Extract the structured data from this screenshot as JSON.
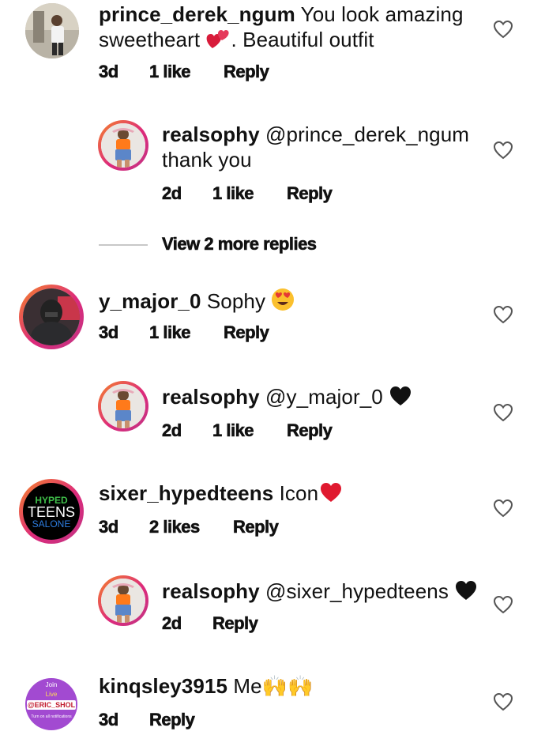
{
  "comments": [
    {
      "username": "prince_derek_ngum",
      "text_line1": " You look amazing",
      "text_line2": "sweetheart",
      "text_line2_after": ". Beautiful outfit",
      "emoji": "two-hearts",
      "age": "3d",
      "likes": "1 like",
      "reply": "Reply"
    },
    {
      "username": "realsophy",
      "text_line1": " @prince_derek_ngum",
      "text_line2": "thank you",
      "age": "2d",
      "likes": "1 like",
      "reply": "Reply"
    },
    {
      "username": "y_major_0",
      "text_line1": " Sophy",
      "emoji": "heart-eyes",
      "age": "3d",
      "likes": "1 like",
      "reply": "Reply"
    },
    {
      "username": "realsophy",
      "text_line1": " @y_major_0",
      "emoji": "black-heart",
      "age": "2d",
      "likes": "1 like",
      "reply": "Reply"
    },
    {
      "username": "sixer_hypedteens",
      "text_line1": " Icon",
      "emoji": "red-heart",
      "age": "3d",
      "likes": "2 likes",
      "reply": "Reply",
      "avatar_text": [
        "HYPED",
        "TEENS",
        "SALONE"
      ]
    },
    {
      "username": "realsophy",
      "text_line1": " @sixer_hypedteens",
      "emoji": "black-heart",
      "age": "2d",
      "reply": "Reply"
    },
    {
      "username": "kinqsley3915",
      "text_line1": " Me🙌🙌",
      "age": "3d",
      "reply": "Reply",
      "avatar_text": [
        "Join",
        "Live",
        "@ERIC_SHOL",
        "Turn on all notifications"
      ]
    }
  ],
  "view_more": "View 2 more replies",
  "colors": {
    "ring_start": "#f58529",
    "ring_end": "#c13584",
    "divider": "#c8c8c8"
  }
}
